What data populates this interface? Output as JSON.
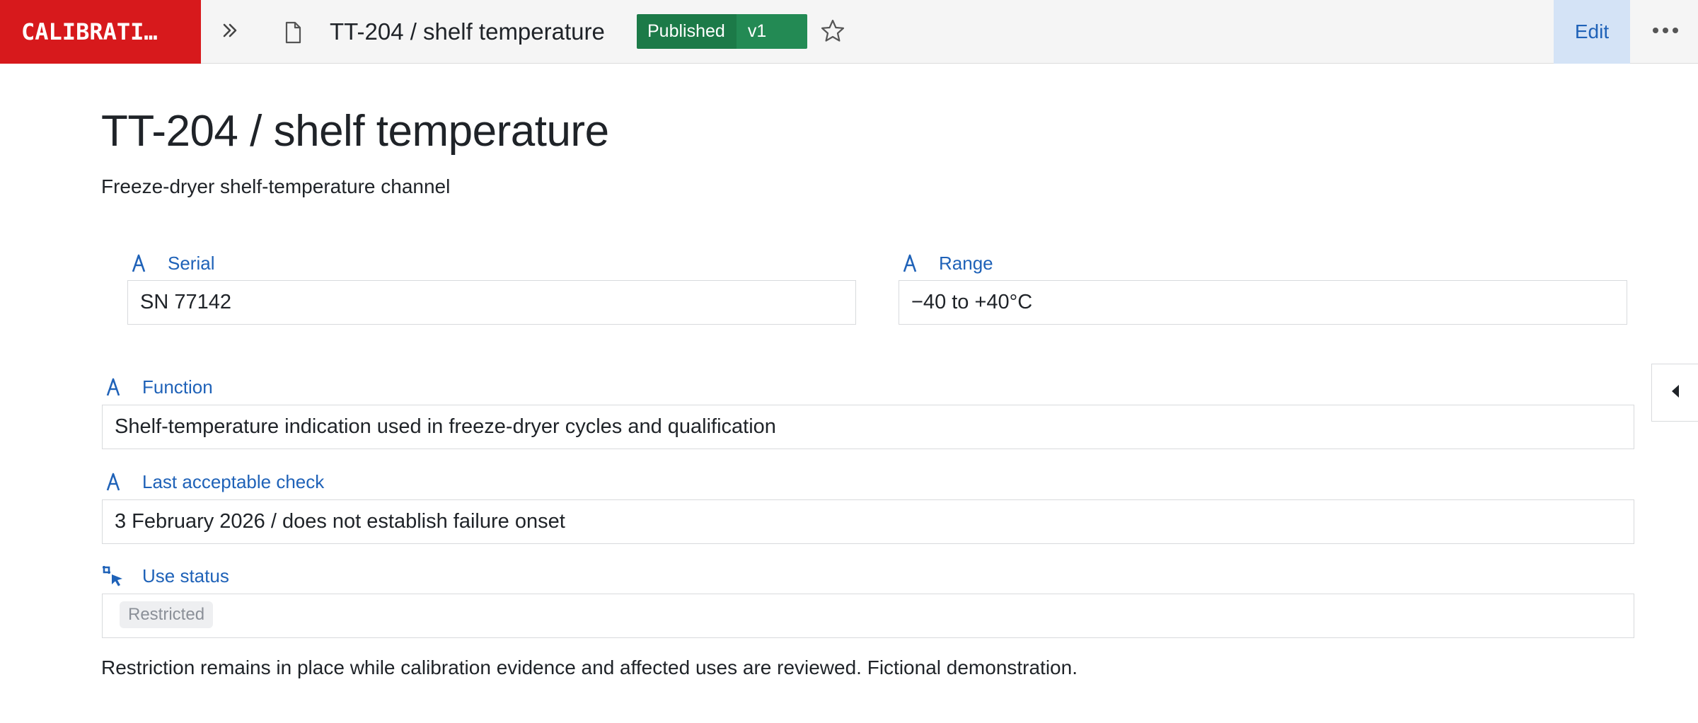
{
  "app": {
    "logo_text": "CALIBRATI…"
  },
  "header": {
    "doc_title": "TT-204 / shelf temperature",
    "status": "Published",
    "version": "v1",
    "edit_label": "Edit"
  },
  "page": {
    "title": "TT-204 / shelf temperature",
    "subtitle": "Freeze-dryer shelf-temperature channel"
  },
  "fields": {
    "serial": {
      "label": "Serial",
      "value": "SN 77142"
    },
    "range": {
      "label": "Range",
      "value": "−40 to +40°C"
    },
    "function": {
      "label": "Function",
      "value": "Shelf-temperature indication used in freeze-dryer cycles and qualification"
    },
    "last_check": {
      "label": "Last acceptable check",
      "value": "3 February 2026 / does not establish failure onset"
    },
    "use_status": {
      "label": "Use status",
      "value": "Restricted"
    }
  },
  "footnote": "Restriction remains in place while calibration evidence and affected uses are reviewed. Fictional demonstration.",
  "icons": {
    "expand": "double-chevron-right-icon",
    "document": "document-icon",
    "star": "star-icon",
    "more": "more-horizontal-icon",
    "text_field": "text-field-icon",
    "selection_field": "selection-field-icon",
    "side_toggle": "caret-left-icon"
  },
  "colors": {
    "brand": "#d7191c",
    "published": "#1c7a48",
    "accent": "#1f62b8"
  }
}
